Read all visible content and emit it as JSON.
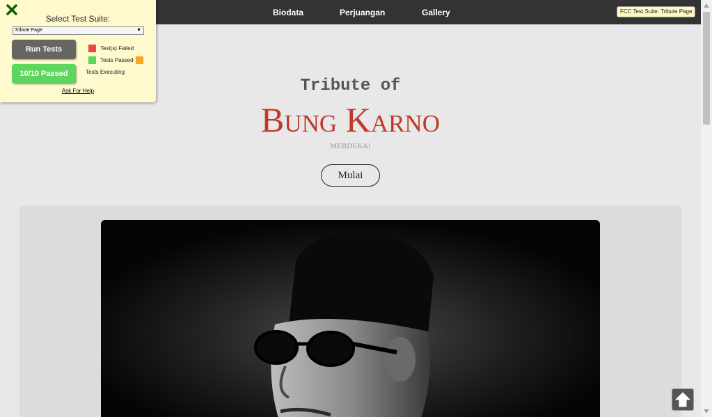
{
  "nav": {
    "links": [
      "Biodata",
      "Perjuangan",
      "Gallery"
    ],
    "badge": "FCC Test Suite: Tribute Page"
  },
  "fcc": {
    "select_label": "Select Test Suite:",
    "selected_suite": "Tribute Page",
    "run_label": "Run Tests",
    "passed_label": "10/10 Passed",
    "legend": {
      "failed": "Test(s) Failed",
      "passed": "Tests Passed",
      "executing": "Tests Executing"
    },
    "help": "Ask For Help",
    "colors": {
      "failed": "#e74c3c",
      "passed": "#5cd65c",
      "executing": "#f5a623",
      "close": "#006400"
    }
  },
  "hero": {
    "subtitle": "Tribute of",
    "title": "Bung Karno",
    "tagline": "MERDEKA!",
    "button": "Mulai"
  },
  "colors": {
    "accent": "#c0392b",
    "nav_bg": "#333333",
    "page_bg": "#e8e8e8"
  },
  "icons": {
    "close": "close-icon",
    "scroll_top": "arrow-up-icon"
  }
}
